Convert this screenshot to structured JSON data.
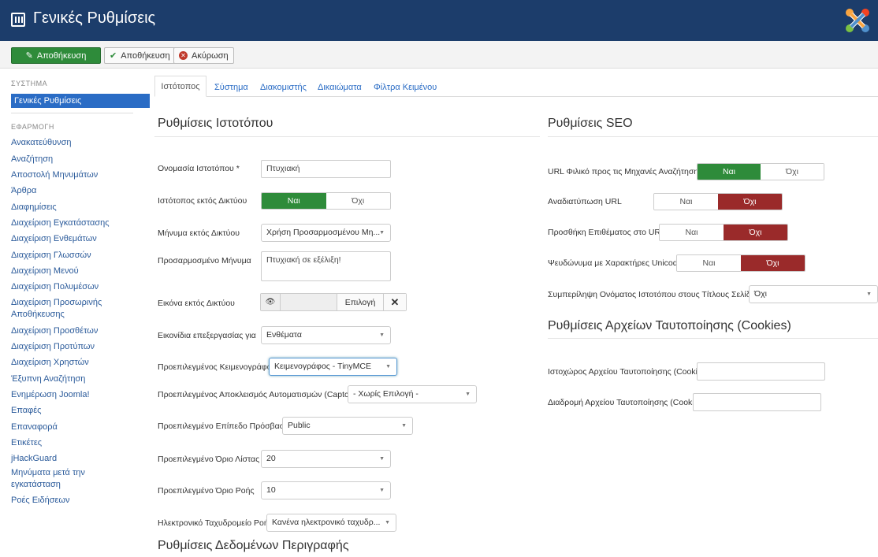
{
  "header": {
    "title": "Γενικές Ρυθμίσεις"
  },
  "toolbar": {
    "save_close": "Αποθήκευση",
    "save": "Αποθήκευση",
    "cancel": "Ακύρωση"
  },
  "sidebar": {
    "system_heading": "ΣΥΣΤΗΜΑ",
    "active_item": "Γενικές Ρυθμίσεις",
    "app_heading": "ΕΦΑΡΜΟΓΗ",
    "items": [
      "Ανακατεύθυνση",
      "Αναζήτηση",
      "Αποστολή Μηνυμάτων",
      "Άρθρα",
      "Διαφημίσεις",
      "Διαχείριση Εγκατάστασης",
      "Διαχείριση Ενθεμάτων",
      "Διαχείριση Γλωσσών",
      "Διαχείριση Μενού",
      "Διαχείριση Πολυμέσων",
      "Διαχείριση Προσωρινής Αποθήκευσης",
      "Διαχείριση Προσθέτων",
      "Διαχείριση Προτύπων",
      "Διαχείριση Χρηστών",
      "Έξυπνη Αναζήτηση",
      "Ενημέρωση Joomla!",
      "Επαφές",
      "Επαναφορά",
      "Ετικέτες",
      "jHackGuard",
      "Μηνύματα μετά την εγκατάσταση",
      "Ροές Ειδήσεων"
    ]
  },
  "tabs": [
    "Ιστότοπος",
    "Σύστημα",
    "Διακομιστής",
    "Δικαιώματα",
    "Φίλτρα Κειμένου"
  ],
  "site": {
    "title": "Ρυθμίσεις Ιστοτόπου",
    "site_name_label": "Ονομασία Ιστοτόπου *",
    "site_name_value": "Πτυχιακή",
    "offline_label": "Ιστότοπος εκτός Δικτύου",
    "offline_msg_label": "Μήνυμα εκτός Δικτύου",
    "offline_msg_value": "Χρήση Προσαρμοσμένου Μη...",
    "custom_msg_label": "Προσαρμοσμένο Μήνυμα",
    "custom_msg_value": "Πτυχιακή σε εξέλιξη!",
    "offline_image_label": "Εικόνα εκτός Δικτύου",
    "offline_image_pick": "Επιλογή",
    "edit_icons_label": "Εικονίδια επεξεργασίας για",
    "edit_icons_value": "Ενθέματα",
    "editor_label": "Προεπιλεγμένος Κειμενογράφος",
    "editor_value": "Κειμενογράφος - TinyMCE",
    "captcha_label": "Προεπιλεγμένος Αποκλεισμός Αυτοματισμών (Captcha)",
    "captcha_value": "- Χωρίς Επιλογή -",
    "access_label": "Προεπιλεγμένο Επίπεδο Πρόσβασης",
    "access_value": "Public",
    "list_limit_label": "Προεπιλεγμένο Όριο Λίστας",
    "list_limit_value": "20",
    "feed_limit_label": "Προεπιλεγμένο Όριο Ροής",
    "feed_limit_value": "10",
    "feed_email_label": "Ηλεκτρονικό Ταχυδρομείο Ροής",
    "feed_email_value": "Κανένα ηλεκτρονικό ταχυδρ...",
    "metadata_title": "Ρυθμίσεις Δεδομένων Περιγραφής"
  },
  "yes": "Ναι",
  "no": "Όχι",
  "seo": {
    "title": "Ρυθμίσεις SEO",
    "sef_label": "URL Φιλικό προς τις Μηχανές Αναζήτησης",
    "rewrite_label": "Αναδιατύπωση URL",
    "suffix_label": "Προσθήκη Επιθέματος στο URL",
    "unicode_label": "Ψευδώνυμα με Χαρακτήρες Unicode",
    "sitename_pages_label": "Συμπερίληψη Ονόματος Ιστοτόπου στους Τίτλους Σελίδων",
    "sitename_pages_value": "Όχι"
  },
  "cookies": {
    "title": "Ρυθμίσεις Αρχείων Ταυτοποίησης (Cookies)",
    "domain_label": "Ιστοχώρος Αρχείου Ταυτοποίησης (Cookie)",
    "path_label": "Διαδρομή Αρχείου Ταυτοποίησης (Cookie)"
  },
  "colors": {
    "header_bg": "#1c3d6b",
    "accent": "#2a6cc5",
    "yes_on": "#2e8b3a",
    "no_on": "#9a2a2a"
  },
  "icons": [
    "settings-icon",
    "joomla-logo",
    "save-icon",
    "check-icon",
    "cancel-icon",
    "eye-icon",
    "clear-icon",
    "chevron-down-icon"
  ]
}
